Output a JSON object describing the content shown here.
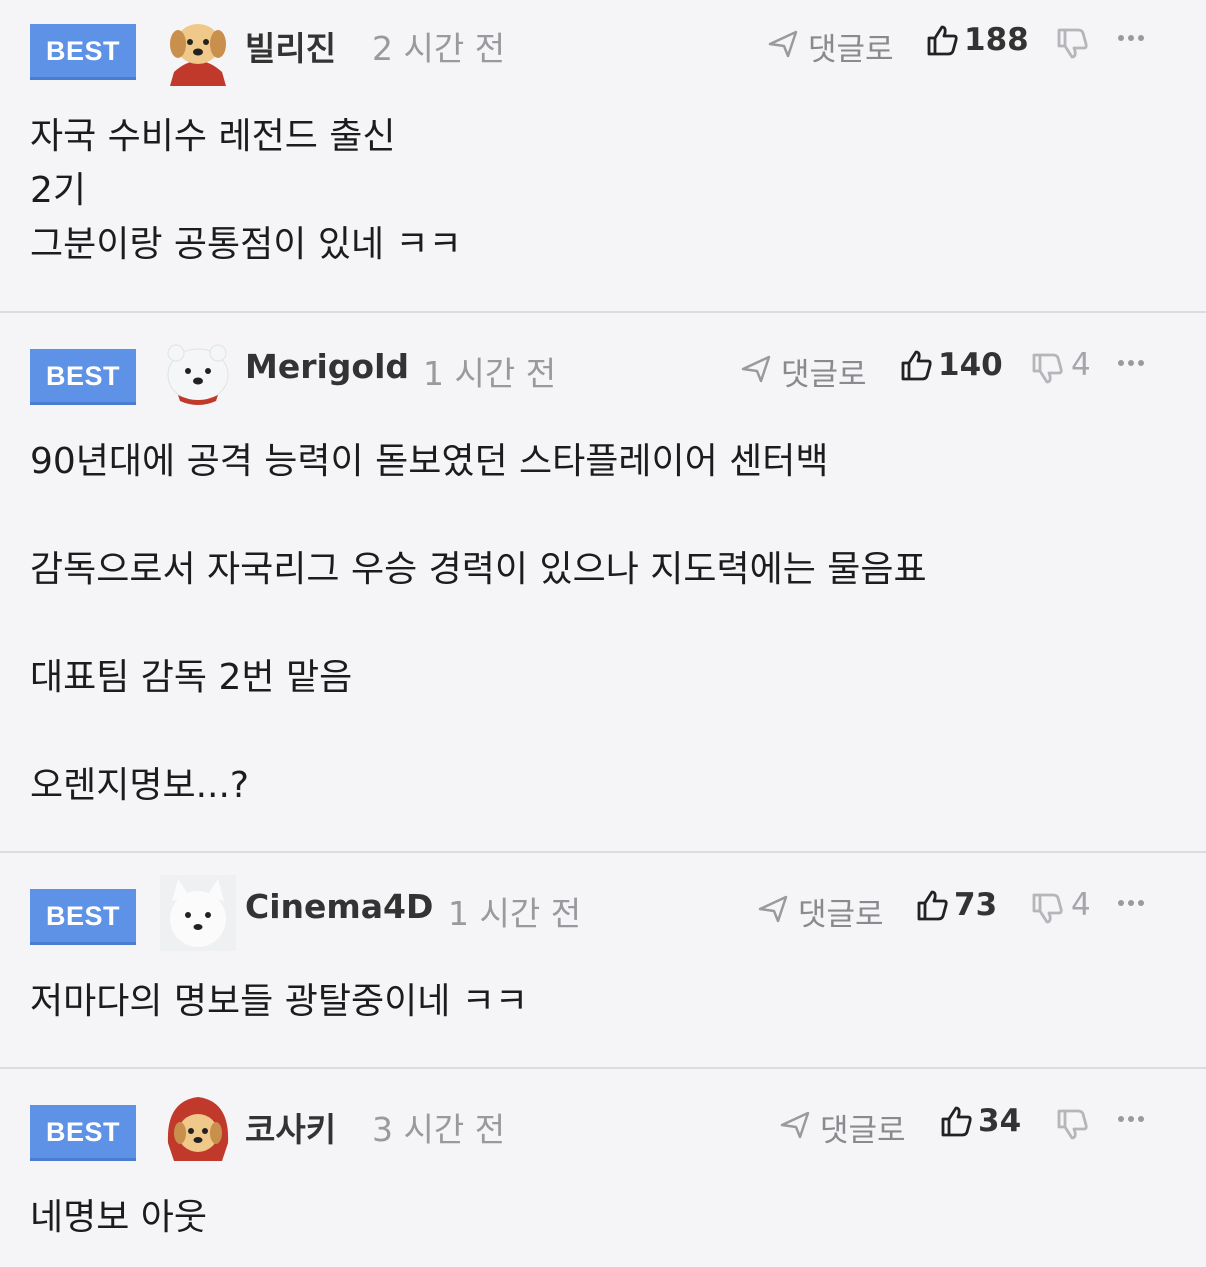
{
  "labels": {
    "best": "BEST",
    "reply": "댓글로"
  },
  "comments": [
    {
      "name": "빌리진",
      "time": "2 시간 전",
      "likes": "188",
      "dislikes": "",
      "lines": [
        "자국 수비수 레전드 출신",
        "2기",
        "그분이랑 공통점이 있네 ㅋㅋ"
      ]
    },
    {
      "name": "Merigold",
      "time": "1 시간 전",
      "likes": "140",
      "dislikes": "4",
      "lines": [
        "90년대에 공격 능력이 돋보였던 스타플레이어 센터백",
        "",
        "감독으로서 자국리그 우승 경력이 있으나 지도력에는 물음표",
        "",
        "대표팀 감독 2번 맡음",
        "",
        "오렌지명보...?"
      ]
    },
    {
      "name": "Cinema4D",
      "time": "1 시간 전",
      "likes": "73",
      "dislikes": "4",
      "lines": [
        "저마다의 명보들 광탈중이네 ㅋㅋ"
      ]
    },
    {
      "name": "코사키",
      "time": "3 시간 전",
      "likes": "34",
      "dislikes": "",
      "lines": [
        "네명보 아웃"
      ]
    }
  ],
  "icons": [
    "puppy-avatar-icon",
    "polar-bear-avatar-icon",
    "white-dog-avatar-icon",
    "puppy-red-hood-avatar-icon",
    "reply-arrow-icon",
    "thumbs-up-icon",
    "thumbs-down-icon",
    "more-options-icon"
  ]
}
